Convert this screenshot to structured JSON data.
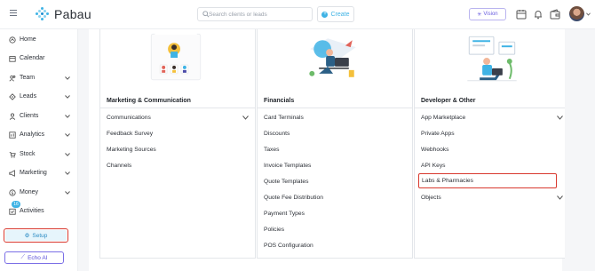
{
  "brand": {
    "name": "Pabau"
  },
  "search": {
    "placeholder": "Search clients or leads"
  },
  "header": {
    "create_label": "Create",
    "vision_label": "Vision"
  },
  "sidebar": {
    "items": [
      {
        "label": "Home",
        "icon": "home-icon"
      },
      {
        "label": "Calendar",
        "icon": "calendar-icon"
      },
      {
        "label": "Team",
        "icon": "team-icon"
      },
      {
        "label": "Leads",
        "icon": "leads-icon"
      },
      {
        "label": "Clients",
        "icon": "clients-icon"
      },
      {
        "label": "Analytics",
        "icon": "analytics-icon"
      },
      {
        "label": "Stock",
        "icon": "stock-icon"
      },
      {
        "label": "Marketing",
        "icon": "marketing-icon"
      },
      {
        "label": "Money",
        "icon": "money-icon"
      },
      {
        "label": "Activities",
        "icon": "activities-icon",
        "badge": "16"
      }
    ],
    "setup_label": "Setup",
    "echo_label": "Echo AI"
  },
  "columns": [
    {
      "title": "Marketing & Communication",
      "rows": [
        "Communications",
        "Feedback Survey",
        "Marketing Sources",
        "Channels"
      ]
    },
    {
      "title": "Financials",
      "rows": [
        "Card Terminals",
        "Discounts",
        "Taxes",
        "Invoice Templates",
        "Quote Templates",
        "Quote Fee Distribution",
        "Payment Types",
        "Policies",
        "POS Configuration"
      ]
    },
    {
      "title": "Developer & Other",
      "rows": [
        "App Marketplace",
        "Private Apps",
        "Webhooks",
        "API Keys",
        "Labs & Pharmacies",
        "Objects"
      ]
    }
  ],
  "colors": {
    "accent": "#3fb3e5",
    "highlight": "#d9392f",
    "ai": "#6a5ee0"
  }
}
